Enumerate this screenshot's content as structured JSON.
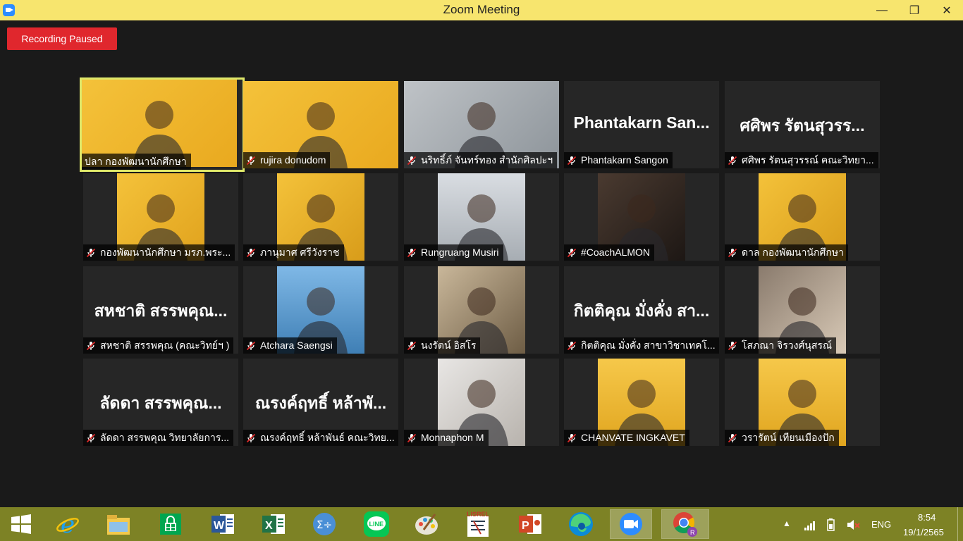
{
  "window": {
    "title": "Zoom Meeting",
    "minimize": "—",
    "maximize": "❐",
    "close": "✕"
  },
  "recording": {
    "label": "Recording Paused"
  },
  "participants": [
    {
      "label": "ปลา กองพัฒนานักศึกษา",
      "kind": "video",
      "active": true,
      "muted": false
    },
    {
      "label": "rujira donudom",
      "kind": "video",
      "muted": true
    },
    {
      "label": "นริทธิ์ภ์ จันทร์ทอง สำนักศิลปะฯ",
      "kind": "video",
      "muted": true
    },
    {
      "label": "Phantakarn Sangon",
      "display": "Phantakarn San...",
      "kind": "name",
      "muted": true
    },
    {
      "label": "ศศิพร รัตนสุวรรณ์ คณะวิทยา...",
      "display": "ศศิพร รัตนสุวรร...",
      "kind": "name",
      "muted": true
    },
    {
      "label": "กองพัฒนานักศึกษา มรภ.พระ...",
      "kind": "video",
      "muted": true
    },
    {
      "label": "ภานุมาศ ศรีวังราช",
      "kind": "video",
      "muted": true
    },
    {
      "label": "Rungruang Musiri",
      "kind": "video",
      "muted": true
    },
    {
      "label": "#CoachALMON",
      "kind": "video",
      "muted": true
    },
    {
      "label": "ดาล กองพัฒนานักศึกษา",
      "kind": "video",
      "muted": true
    },
    {
      "label": "สหชาติ สรรพคุณ (คณะวิทย์ฯ )",
      "display": "สหชาติ สรรพคุณ...",
      "kind": "name",
      "muted": true
    },
    {
      "label": "Atchara Saengsi",
      "kind": "video",
      "muted": true
    },
    {
      "label": "นงรัตน์ อิสโร",
      "kind": "video",
      "muted": true
    },
    {
      "label": "กิตติคุณ มั่งคั่ง สาขาวิชาเทคโ...",
      "display": "กิตติคุณ มั่งคั่ง สา...",
      "kind": "name",
      "muted": true
    },
    {
      "label": "โสภณา จิรวงศ์นุสรณ์",
      "kind": "video",
      "muted": true
    },
    {
      "label": "ลัดดา สรรพคุณ วิทยาลัยการ...",
      "display": "ลัดดา สรรพคุณ...",
      "kind": "name",
      "muted": true
    },
    {
      "label": "ณรงค์ฤทธิ์ หล้าพันธ์ คณะวิทย...",
      "display": "ณรงค์ฤทธิ์ หล้าพั...",
      "kind": "name",
      "muted": true
    },
    {
      "label": "Monnaphon M",
      "kind": "video",
      "muted": true
    },
    {
      "label": "CHANVATE INGKAVET",
      "kind": "video",
      "muted": true
    },
    {
      "label": "วรารัตน์ เทียนเมืองปัก",
      "kind": "video",
      "muted": true
    }
  ],
  "taskbar": {
    "apps": [
      "start-icon",
      "internet-explorer-icon",
      "file-explorer-icon",
      "store-icon",
      "word-icon",
      "excel-icon",
      "math-input-icon",
      "line-icon",
      "paint-icon",
      "lisrel-icon",
      "powerpoint-icon",
      "edge-icon",
      "zoom-icon",
      "chrome-icon"
    ],
    "app_text": {
      "lisrel": "LISREL"
    },
    "language": "ENG",
    "time": "8:54",
    "date": "19/1/2565"
  },
  "colors": {
    "titlebar": "#f7e56e",
    "taskbar": "#7d8225",
    "recording": "#e0272d",
    "active_border": "#dfe86a",
    "tile": "#262626"
  }
}
